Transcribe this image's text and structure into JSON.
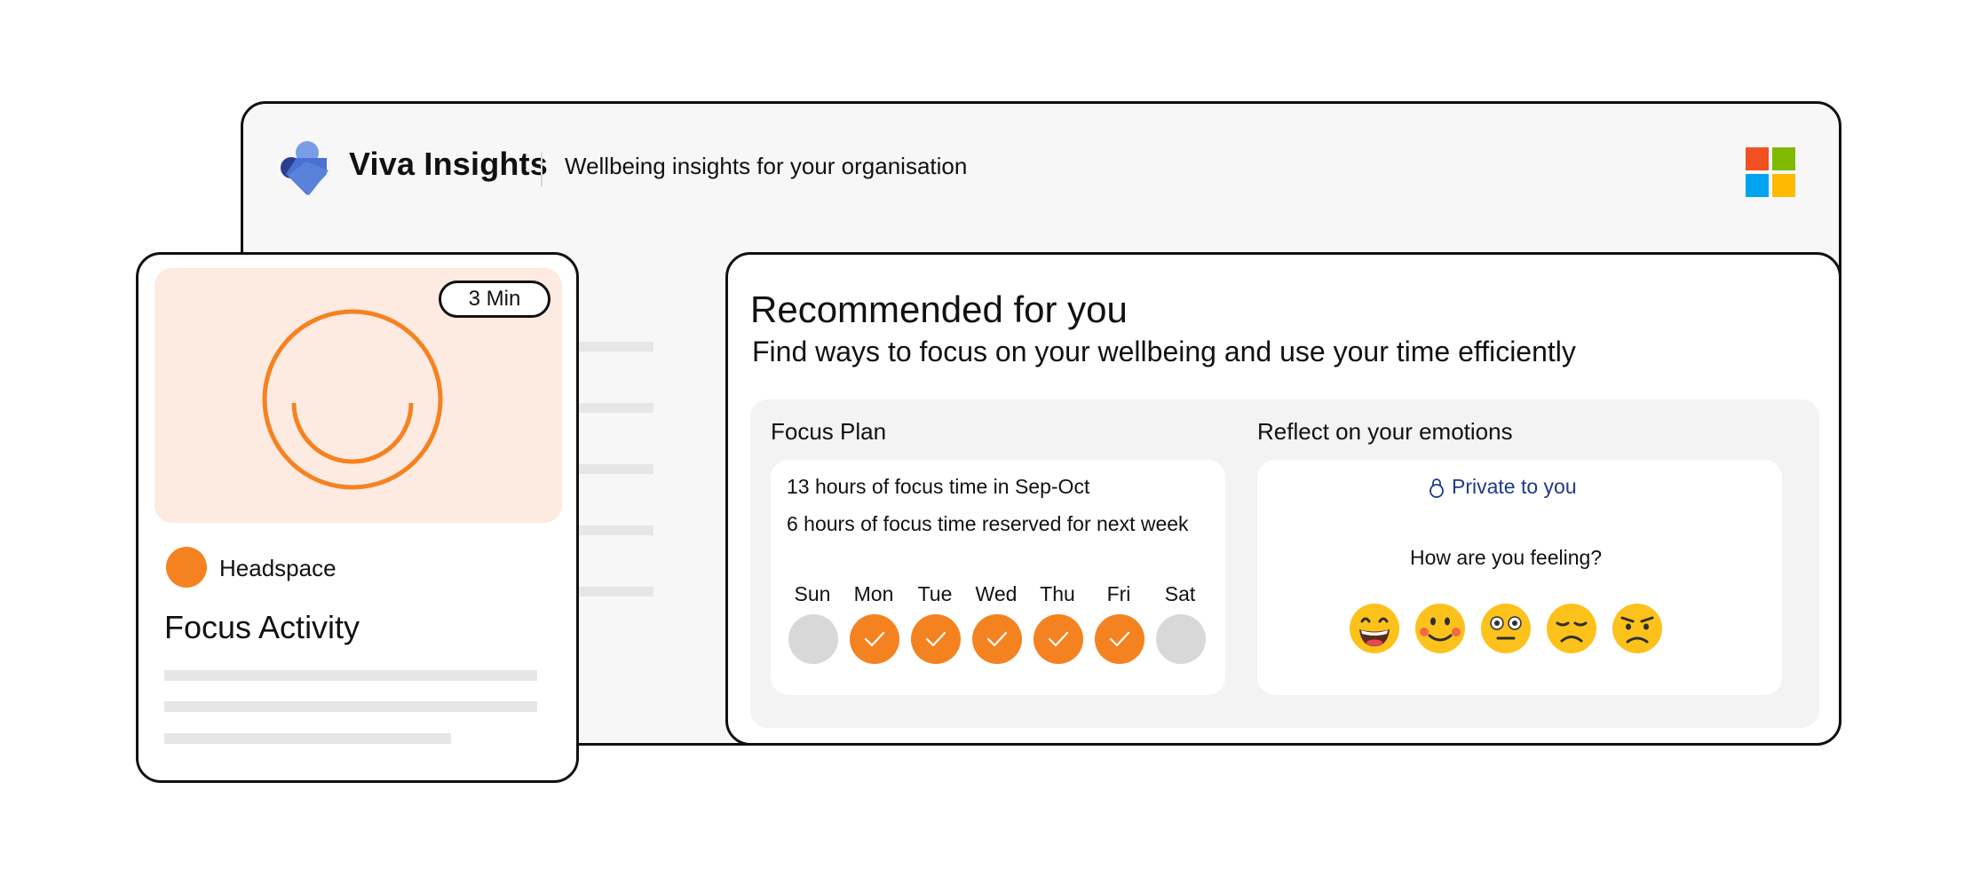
{
  "header": {
    "app_name": "Viva Insights",
    "tagline": "Wellbeing insights for your organisation",
    "logo_icon": "viva-heart-icon",
    "brand_icon": "microsoft-logo-icon",
    "ms_colors": [
      "#f25022",
      "#7fba00",
      "#00a4ef",
      "#ffb900"
    ]
  },
  "activity_card": {
    "duration": "3 Min",
    "provider": "Headspace",
    "title": "Focus Activity",
    "accent_color": "#f58220"
  },
  "recommended": {
    "title": "Recommended for you",
    "subtitle": "Find ways to focus on your wellbeing and use your time efficiently"
  },
  "focus_plan": {
    "heading": "Focus Plan",
    "stat_1": "13 hours of focus time in Sep-Oct",
    "stat_2": "6 hours of focus time reserved for next week",
    "days": [
      {
        "label": "Sun",
        "done": false
      },
      {
        "label": "Mon",
        "done": true
      },
      {
        "label": "Tue",
        "done": true
      },
      {
        "label": "Wed",
        "done": true
      },
      {
        "label": "Thu",
        "done": true
      },
      {
        "label": "Fri",
        "done": true
      },
      {
        "label": "Sat",
        "done": false
      }
    ]
  },
  "emotions": {
    "heading": "Reflect on your emotions",
    "privacy": "Private to you",
    "privacy_icon": "lock-icon",
    "question": "How are you feeling?",
    "options": [
      "grinning-face-icon",
      "smiling-face-icon",
      "neutral-face-icon",
      "sad-face-icon",
      "frowning-face-icon"
    ]
  }
}
